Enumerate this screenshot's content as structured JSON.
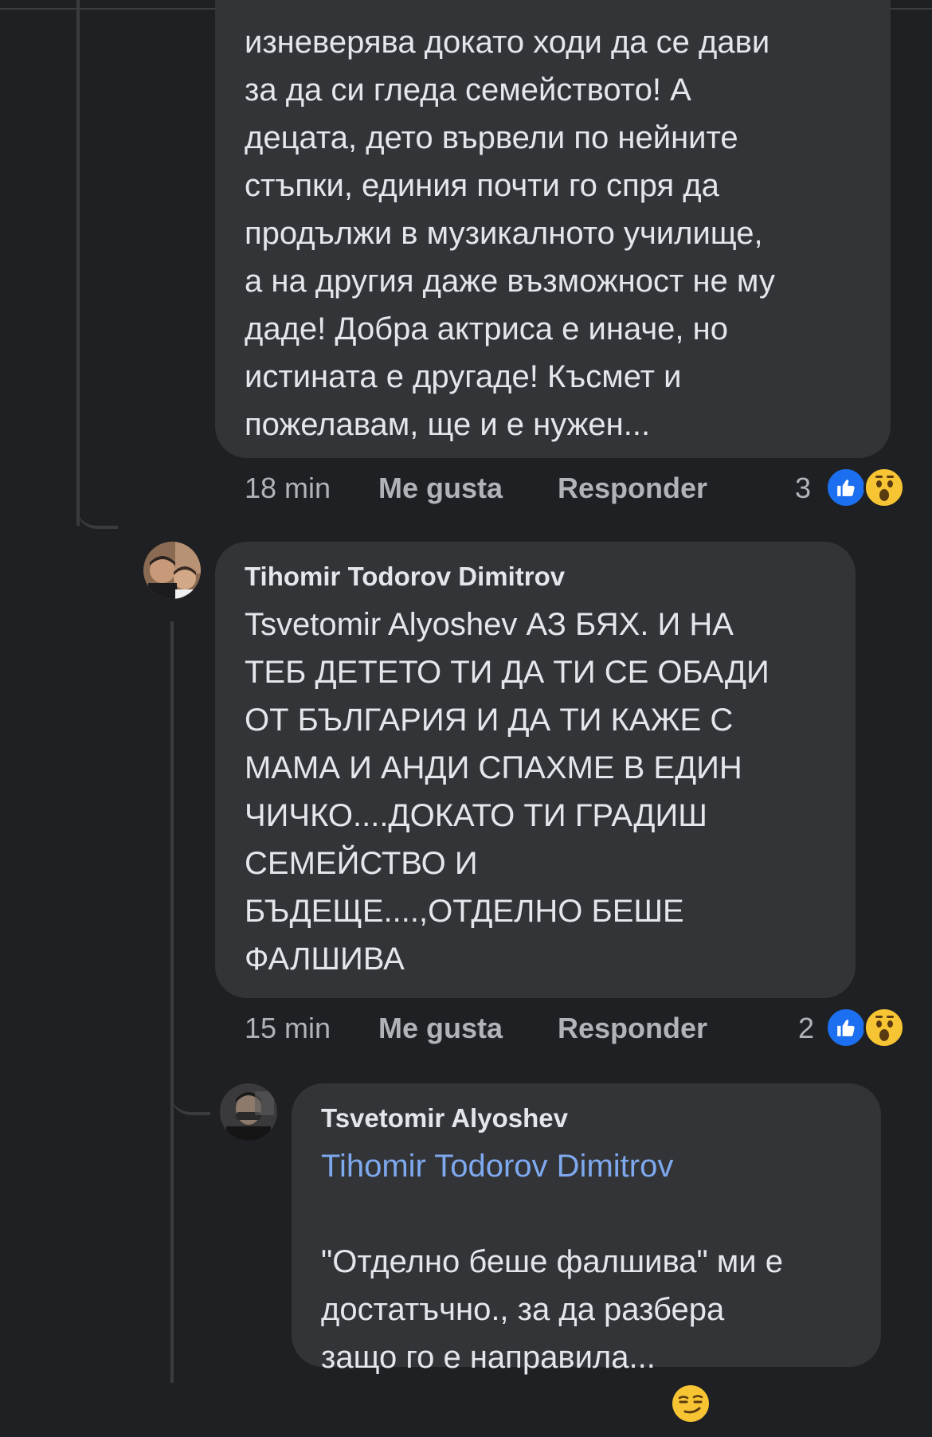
{
  "comments": [
    {
      "text": "изневерява докато ходи да се дави\nза да си гледа семейството! А\nдецата, дето вървели по нейните\nстъпки, единия почти го спря да\nпродължи в музикалното училище,\nа на другия даже възможност не му\nдаде! Добра актриса е иначе, но\nистината е другаде! Късмет и\nпожелавам, ще и е нужен...",
      "time": "18 min",
      "like_label": "Me gusta",
      "reply_label": "Responder",
      "reaction_count": "3",
      "reactions": [
        "like-icon",
        "wow-icon"
      ]
    },
    {
      "author": "Tihomir Todorov Dimitrov",
      "text": "Tsvetomir Alyoshev АЗ БЯХ. И НА\nТЕБ ДЕТЕТО ТИ ДА ТИ СЕ ОБАДИ\nОТ БЪЛГАРИЯ И ДА ТИ КАЖЕ С\nМАМА  И АНДИ СПАХМЕ В ЕДИН\nЧИЧКО....ДОКАТО ТИ ГРАДИШ\nСЕМЕЙСТВО И\nБЪДЕЩЕ....,ОТДЕЛНО БЕШЕ\nФАЛШИВА",
      "time": "15 min",
      "like_label": "Me gusta",
      "reply_label": "Responder",
      "reaction_count": "2",
      "reactions": [
        "like-icon",
        "wow-icon"
      ]
    },
    {
      "author": "Tsvetomir Alyoshev",
      "mention": "Tihomir Todorov Dimitrov",
      "text": "\"Отделно беше фалшива\" ми е\nдостатъчно., за да разбера\nзащо го е направила... ",
      "emoji": "smirk-emoji"
    }
  ],
  "colors": {
    "background": "#1f2023",
    "bubble": "#333437",
    "mention": "#7ea9ef",
    "meta": "#b0b3b8",
    "like_badge": "#1b6ff0",
    "wow_badge": "#f7c533"
  }
}
